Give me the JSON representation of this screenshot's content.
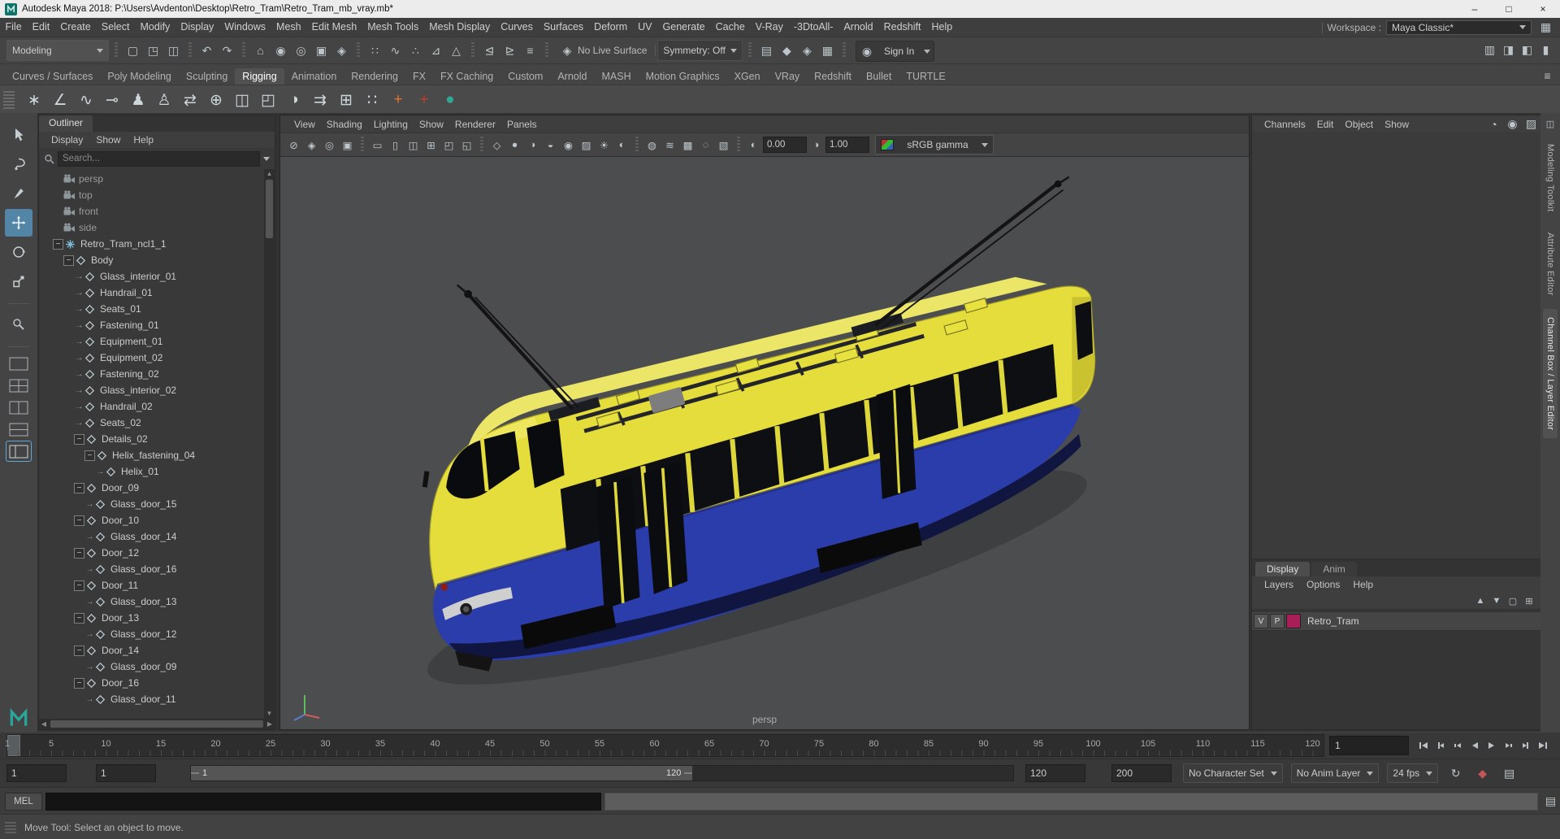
{
  "colors": {
    "accent": "#5285a6",
    "tram_yellow": "#e4dd3b",
    "tram_blue": "#2b3daa",
    "layer_color": "#a81e56",
    "viewport_bg": "#4b4d4f"
  },
  "window": {
    "title": "Autodesk Maya 2018: P:\\Users\\Avdenton\\Desktop\\Retro_Tram\\Retro_Tram_mb_vray.mb*",
    "controls": {
      "minimize": "–",
      "maximize": "□",
      "close": "×"
    }
  },
  "menu_bar": {
    "items": [
      "File",
      "Edit",
      "Create",
      "Select",
      "Modify",
      "Display",
      "Windows",
      "Mesh",
      "Edit Mesh",
      "Mesh Tools",
      "Mesh Display",
      "Curves",
      "Surfaces",
      "Deform",
      "UV",
      "Generate",
      "Cache",
      "V-Ray",
      "-3DtoAll-",
      "Arnold",
      "Redshift",
      "Help"
    ],
    "workspace_label": "Workspace :",
    "workspace_value": "Maya Classic*"
  },
  "status_line": {
    "mode": "Modeling",
    "file_icons": [
      {
        "name": "new-scene-icon",
        "glyph": "▢"
      },
      {
        "name": "open-scene-icon",
        "glyph": "◳"
      },
      {
        "name": "save-scene-icon",
        "glyph": "◫"
      }
    ],
    "undo_icons": [
      {
        "name": "undo-icon",
        "glyph": "↶"
      },
      {
        "name": "redo-icon",
        "glyph": "↷"
      }
    ],
    "selection_icons": [
      {
        "name": "select-hierarchy-icon",
        "glyph": "⌂"
      },
      {
        "name": "select-object-icon",
        "glyph": "◉"
      },
      {
        "name": "select-component-icon",
        "glyph": "◎"
      },
      {
        "name": "selection-preset-icon",
        "glyph": "▣"
      },
      {
        "name": "highlight-selection-icon",
        "glyph": "◈"
      }
    ],
    "snap_icons": [
      {
        "name": "snap-grid-icon",
        "glyph": "∷"
      },
      {
        "name": "snap-curve-icon",
        "glyph": "∿"
      },
      {
        "name": "snap-point-icon",
        "glyph": "∴"
      },
      {
        "name": "snap-plane-icon",
        "glyph": "⊿"
      },
      {
        "name": "make-live-icon",
        "glyph": "△"
      }
    ],
    "history_icons": [
      {
        "name": "input-connections-icon",
        "glyph": "⊴"
      },
      {
        "name": "output-connections-icon",
        "glyph": "⊵"
      },
      {
        "name": "construction-history-icon",
        "glyph": "≡"
      }
    ],
    "live_surface": "No Live Surface",
    "symmetry": "Symmetry: Off",
    "render_icons": [
      {
        "name": "open-render-view-icon",
        "glyph": "▤"
      },
      {
        "name": "render-current-frame-icon",
        "glyph": "◆"
      },
      {
        "name": "ipr-render-icon",
        "glyph": "◈"
      },
      {
        "name": "render-settings-icon",
        "glyph": "▦"
      }
    ],
    "pause_icons": [
      {
        "name": "pause-viewport-icon",
        "glyph": "‖"
      },
      {
        "name": "evaluation-mode-icon",
        "glyph": "▮"
      }
    ],
    "sign_in": "Sign In",
    "sidebar_toggle_icons": [
      {
        "name": "modeling-toolkit-toggle-icon",
        "glyph": "▥"
      },
      {
        "name": "hypershade-toggle-icon",
        "glyph": "◨"
      },
      {
        "name": "attribute-editor-toggle-icon",
        "glyph": "◧"
      },
      {
        "name": "channel-box-toggle-icon",
        "glyph": "▮"
      }
    ]
  },
  "shelf": {
    "tabs": [
      {
        "label": "Curves / Surfaces"
      },
      {
        "label": "Poly Modeling"
      },
      {
        "label": "Sculpting"
      },
      {
        "label": "Rigging",
        "active": true
      },
      {
        "label": "Animation"
      },
      {
        "label": "Rendering"
      },
      {
        "label": "FX"
      },
      {
        "label": "FX Caching"
      },
      {
        "label": "Custom"
      },
      {
        "label": "Arnold"
      },
      {
        "label": "MASH"
      },
      {
        "label": "Motion Graphics"
      },
      {
        "label": "XGen"
      },
      {
        "label": "VRay"
      },
      {
        "label": "Redshift"
      },
      {
        "label": "Bullet"
      },
      {
        "label": "TURTLE"
      }
    ],
    "icons": [
      {
        "name": "joint-tool-icon",
        "glyph": "∗",
        "color": "#cdd6da"
      },
      {
        "name": "ik-handle-icon",
        "glyph": "∠",
        "color": "#cdd6da"
      },
      {
        "name": "ik-spline-handle-icon",
        "glyph": "∿",
        "color": "#cdd6da"
      },
      {
        "name": "insert-joint-icon",
        "glyph": "⊸",
        "color": "#cdd6da"
      },
      {
        "name": "humanik-character-icon",
        "glyph": "♟",
        "color": "#cdd6da"
      },
      {
        "name": "quick-rig-icon",
        "glyph": "♙",
        "color": "#cdd6da"
      },
      {
        "name": "mirror-joint-icon",
        "glyph": "⇄",
        "color": "#cdd6da"
      },
      {
        "name": "orient-joint-icon",
        "glyph": "⊕",
        "color": "#cdd6da"
      },
      {
        "name": "bind-skin-icon",
        "glyph": "◫",
        "color": "#cdd6da"
      },
      {
        "name": "unbind-skin-icon",
        "glyph": "◰",
        "color": "#cdd6da"
      },
      {
        "name": "paint-skin-weights-icon",
        "glyph": "◑",
        "color": "#cdd6da"
      },
      {
        "name": "copy-skin-weights-icon",
        "glyph": "⇉",
        "color": "#cdd6da"
      },
      {
        "name": "lattice-icon",
        "glyph": "⊞",
        "color": "#cdd6da"
      },
      {
        "name": "cluster-icon",
        "glyph": "∷",
        "color": "#cdd6da"
      },
      {
        "name": "add-influence-icon",
        "glyph": "+",
        "color": "#e0762e"
      },
      {
        "name": "remove-influence-icon",
        "glyph": "+",
        "color": "#c43b2a"
      },
      {
        "name": "turtle-plugin-icon",
        "glyph": "●",
        "color": "#2fa893"
      }
    ]
  },
  "outliner": {
    "tab": "Outliner",
    "menus": [
      "Display",
      "Show",
      "Help"
    ],
    "search_placeholder": "Search...",
    "items": [
      {
        "label": "persp",
        "level": 1,
        "icon": "camera",
        "expander": "none",
        "dim": true
      },
      {
        "label": "top",
        "level": 1,
        "icon": "camera",
        "expander": "none",
        "dim": true
      },
      {
        "label": "front",
        "level": 1,
        "icon": "camera",
        "expander": "none",
        "dim": true
      },
      {
        "label": "side",
        "level": 1,
        "icon": "camera",
        "expander": "none",
        "dim": true
      },
      {
        "label": "Retro_Tram_ncl1_1",
        "level": 1,
        "icon": "star",
        "expander": "minus"
      },
      {
        "label": "Body",
        "level": 2,
        "icon": "mesh",
        "expander": "minus"
      },
      {
        "label": "Glass_interior_01",
        "level": 3,
        "icon": "mesh",
        "expander": "arrow"
      },
      {
        "label": "Handrail_01",
        "level": 3,
        "icon": "mesh",
        "expander": "arrow"
      },
      {
        "label": "Seats_01",
        "level": 3,
        "icon": "mesh",
        "expander": "arrow"
      },
      {
        "label": "Fastening_01",
        "level": 3,
        "icon": "mesh",
        "expander": "arrow"
      },
      {
        "label": "Equipment_01",
        "level": 3,
        "icon": "mesh",
        "expander": "arrow"
      },
      {
        "label": "Equipment_02",
        "level": 3,
        "icon": "mesh",
        "expander": "arrow"
      },
      {
        "label": "Fastening_02",
        "level": 3,
        "icon": "mesh",
        "expander": "arrow"
      },
      {
        "label": "Glass_interior_02",
        "level": 3,
        "icon": "mesh",
        "expander": "arrow"
      },
      {
        "label": "Handrail_02",
        "level": 3,
        "icon": "mesh",
        "expander": "arrow"
      },
      {
        "label": "Seats_02",
        "level": 3,
        "icon": "mesh",
        "expander": "arrow"
      },
      {
        "label": "Details_02",
        "level": 3,
        "icon": "mesh",
        "expander": "minus"
      },
      {
        "label": "Helix_fastening_04",
        "level": 4,
        "icon": "mesh",
        "expander": "minus"
      },
      {
        "label": "Helix_01",
        "level": 5,
        "icon": "mesh",
        "expander": "arrow"
      },
      {
        "label": "Door_09",
        "level": 3,
        "icon": "mesh",
        "expander": "minus"
      },
      {
        "label": "Glass_door_15",
        "level": 4,
        "icon": "mesh",
        "expander": "arrow"
      },
      {
        "label": "Door_10",
        "level": 3,
        "icon": "mesh",
        "expander": "minus"
      },
      {
        "label": "Glass_door_14",
        "level": 4,
        "icon": "mesh",
        "expander": "arrow"
      },
      {
        "label": "Door_12",
        "level": 3,
        "icon": "mesh",
        "expander": "minus"
      },
      {
        "label": "Glass_door_16",
        "level": 4,
        "icon": "mesh",
        "expander": "arrow"
      },
      {
        "label": "Door_11",
        "level": 3,
        "icon": "mesh",
        "expander": "minus"
      },
      {
        "label": "Glass_door_13",
        "level": 4,
        "icon": "mesh",
        "expander": "arrow"
      },
      {
        "label": "Door_13",
        "level": 3,
        "icon": "mesh",
        "expander": "minus"
      },
      {
        "label": "Glass_door_12",
        "level": 4,
        "icon": "mesh",
        "expander": "arrow"
      },
      {
        "label": "Door_14",
        "level": 3,
        "icon": "mesh",
        "expander": "minus"
      },
      {
        "label": "Glass_door_09",
        "level": 4,
        "icon": "mesh",
        "expander": "arrow"
      },
      {
        "label": "Door_16",
        "level": 3,
        "icon": "mesh",
        "expander": "minus"
      },
      {
        "label": "Glass_door_11",
        "level": 4,
        "icon": "mesh",
        "expander": "arrow"
      }
    ]
  },
  "viewport": {
    "menus": [
      "View",
      "Shading",
      "Lighting",
      "Show",
      "Renderer",
      "Panels"
    ],
    "toolbar_icons_a": [
      {
        "name": "select-camera-icon",
        "glyph": "⊘"
      },
      {
        "name": "lock-camera-icon",
        "glyph": "◈"
      },
      {
        "name": "camera-attributes-icon",
        "glyph": "◎"
      },
      {
        "name": "bookmark-icon",
        "glyph": "▣"
      }
    ],
    "toolbar_icons_b": [
      {
        "name": "film-gate-icon",
        "glyph": "▭"
      },
      {
        "name": "resolution-gate-icon",
        "glyph": "▯"
      },
      {
        "name": "gate-mask-icon",
        "glyph": "◫"
      },
      {
        "name": "field-chart-icon",
        "glyph": "⊞"
      },
      {
        "name": "safe-action-icon",
        "glyph": "◰"
      },
      {
        "name": "safe-title-icon",
        "glyph": "◱"
      }
    ],
    "toolbar_icons_c": [
      {
        "name": "wireframe-icon",
        "glyph": "◇"
      },
      {
        "name": "shaded-icon",
        "glyph": "●"
      },
      {
        "name": "textured-icon",
        "glyph": "◑"
      },
      {
        "name": "use-default-material-icon",
        "glyph": "◒"
      },
      {
        "name": "wireframe-on-shaded-icon",
        "glyph": "◉"
      },
      {
        "name": "xray-icon",
        "glyph": "▨"
      },
      {
        "name": "lighting-icon",
        "glyph": "☀"
      },
      {
        "name": "shadows-icon",
        "glyph": "◐"
      }
    ],
    "toolbar_icons_d": [
      {
        "name": "screen-space-ao-icon",
        "glyph": "◍"
      },
      {
        "name": "motion-blur-icon",
        "glyph": "≋"
      },
      {
        "name": "multisample-aa-icon",
        "glyph": "▩"
      },
      {
        "name": "depth-of-field-icon",
        "glyph": "◌"
      },
      {
        "name": "isolate-select-icon",
        "glyph": "▧"
      }
    ],
    "exposure": "0.00",
    "gamma": "1.00",
    "view_transform": "sRGB gamma",
    "camera": "persp"
  },
  "channel_box": {
    "menus": [
      "Channels",
      "Edit",
      "Object",
      "Show"
    ],
    "header_icons": [
      {
        "name": "channel-slider-mode-icon",
        "glyph": "◔"
      },
      {
        "name": "channel-speed-icon",
        "glyph": "◉"
      },
      {
        "name": "channel-settings-icon",
        "glyph": "▨"
      }
    ]
  },
  "layer_editor": {
    "tabs": [
      {
        "label": "Display",
        "active": true
      },
      {
        "label": "Anim"
      }
    ],
    "menus": [
      "Layers",
      "Options",
      "Help"
    ],
    "toolbar_icons": [
      {
        "name": "layer-move-up-icon",
        "glyph": "▲"
      },
      {
        "name": "layer-move-down-icon",
        "glyph": "▼"
      },
      {
        "name": "create-empty-layer-icon",
        "glyph": "▢"
      },
      {
        "name": "create-layer-from-selected-icon",
        "glyph": "⊞"
      }
    ],
    "layers": [
      {
        "visibility": "V",
        "playback": "P",
        "name": "Retro_Tram",
        "swatch": "#a81e56"
      }
    ]
  },
  "right_sidebar": {
    "tabs": [
      {
        "label": "Modeling Toolkit"
      },
      {
        "label": "Attribute Editor"
      },
      {
        "label": "Channel Box / Layer Editor",
        "active": true
      }
    ]
  },
  "time_slider": {
    "ticks": [
      1,
      5,
      10,
      15,
      20,
      25,
      30,
      35,
      40,
      45,
      50,
      55,
      60,
      65,
      70,
      75,
      80,
      85,
      90,
      95,
      100,
      105,
      110,
      115,
      120
    ],
    "current_frame": "1"
  },
  "range_slider": {
    "animation_start": "1",
    "playback_start": "1",
    "range_start_label": "1",
    "range_end_label": "120",
    "playback_end": "120",
    "animation_end": "200",
    "character_set": "No Character Set",
    "anim_layer": "No Anim Layer",
    "fps": "24 fps"
  },
  "command_line": {
    "mel_label": "MEL"
  },
  "help_line": {
    "message": "Move Tool: Select an object to move."
  }
}
